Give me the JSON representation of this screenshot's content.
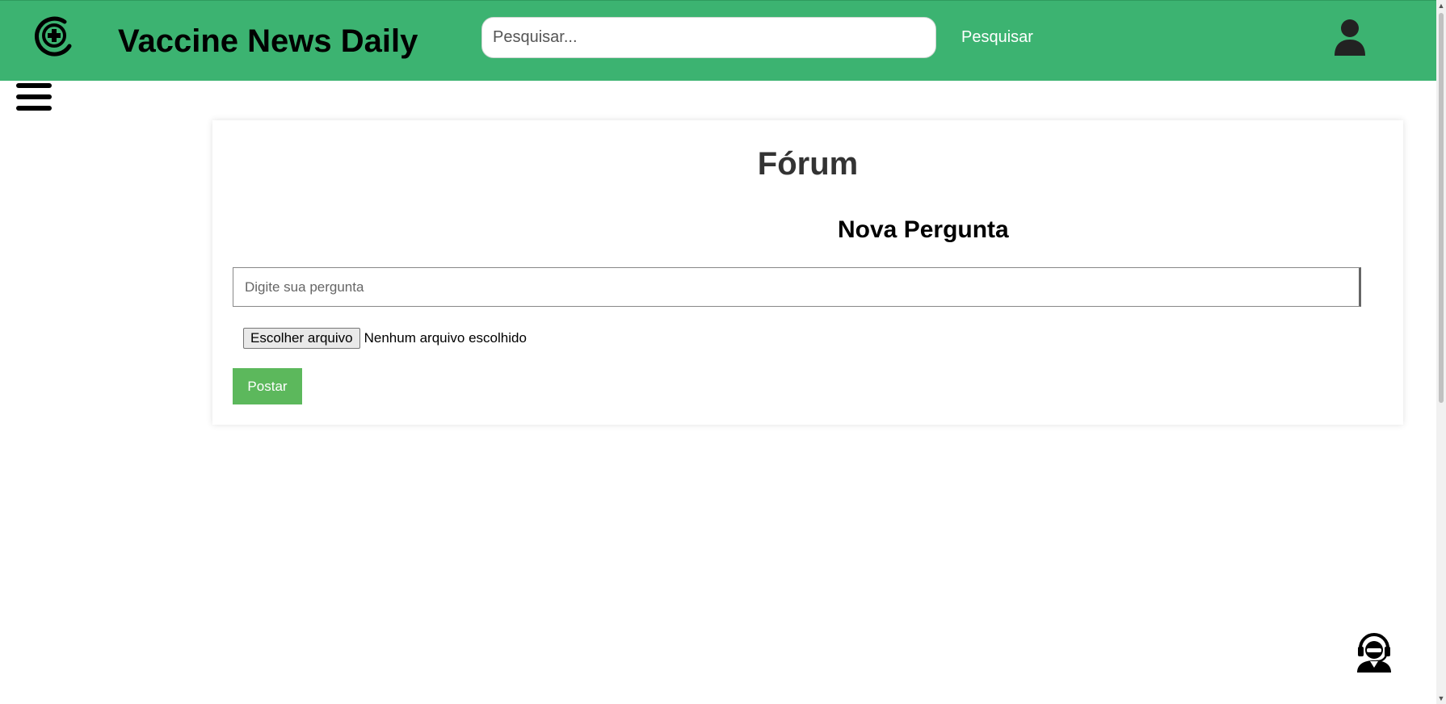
{
  "header": {
    "logo_icon": "medical-cross-circle-icon",
    "site_title": "Vaccine News Daily",
    "search": {
      "placeholder": "Pesquisar...",
      "value": "",
      "button_label": "Pesquisar"
    },
    "user_icon": "user-account-icon",
    "background_color": "#3cb371"
  },
  "nav": {
    "menu_icon": "hamburger-menu-icon"
  },
  "main": {
    "page_title": "Fórum",
    "form": {
      "section_title": "Nova Pergunta",
      "question_placeholder": "Digite sua pergunta",
      "question_value": "",
      "file_button_label": "Escolher arquivo",
      "file_status": "Nenhum arquivo escolhido",
      "submit_label": "Postar",
      "submit_color": "#5cb85c"
    }
  },
  "support": {
    "icon": "customer-support-headset-icon"
  }
}
